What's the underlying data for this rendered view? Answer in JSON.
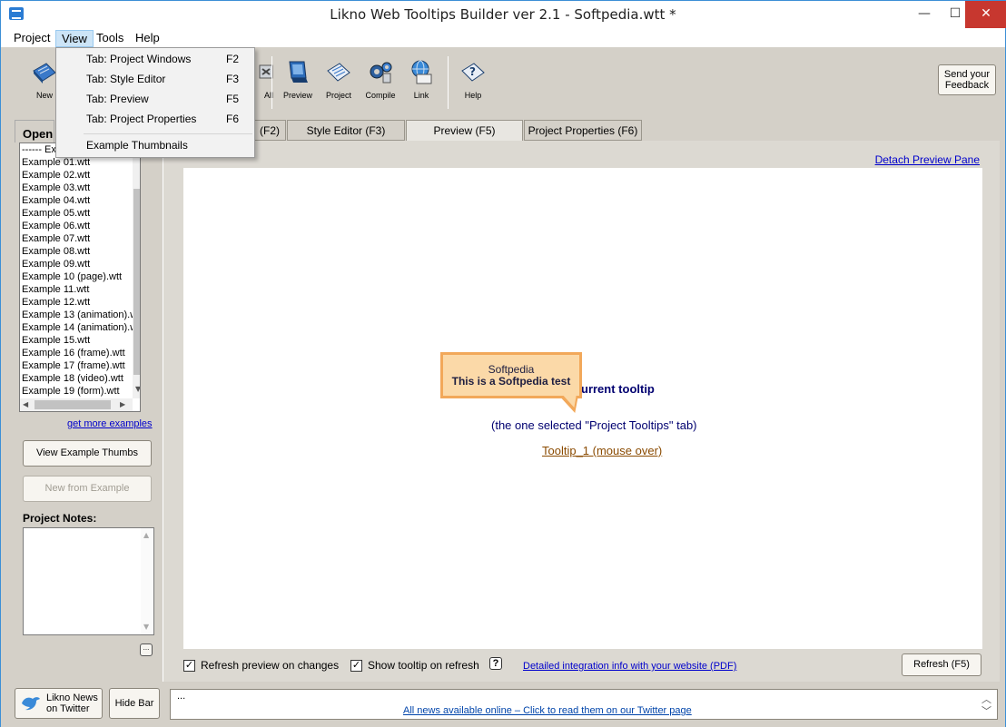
{
  "window": {
    "title": "Likno Web Tooltips Builder ver 2.1 - Softpedia.wtt *",
    "min": "—",
    "max": "☐",
    "close": "✕"
  },
  "menubar": {
    "items": [
      "Project",
      "View",
      "Tools",
      "Help"
    ],
    "active": "View"
  },
  "view_menu": {
    "items": [
      {
        "label": "Tab: Project Windows",
        "shortcut": "F2"
      },
      {
        "label": "Tab: Style Editor",
        "shortcut": "F3"
      },
      {
        "label": "Tab: Preview",
        "shortcut": "F5"
      },
      {
        "label": "Tab: Project Properties",
        "shortcut": "F6"
      },
      {
        "label": "Example Thumbnails",
        "shortcut": ""
      }
    ]
  },
  "toolbar": {
    "new": "New",
    "all": "All",
    "preview": "Preview",
    "project": "Project",
    "compile": "Compile",
    "link": "Link",
    "help": "Help",
    "feedback_line1": "Send your",
    "feedback_line2": "Feedback"
  },
  "tabs": [
    {
      "label": "(F2)",
      "active": false
    },
    {
      "label": "Style Editor   (F3)",
      "active": false
    },
    {
      "label": "Preview   (F5)",
      "active": true
    },
    {
      "label": "Project Properties   (F6)",
      "active": false
    }
  ],
  "left_panel": {
    "open_label": "Open",
    "files": [
      "------ Exa",
      "Example 01.wtt",
      "Example 02.wtt",
      "Example 03.wtt",
      "Example 04.wtt",
      "Example 05.wtt",
      "Example 06.wtt",
      "Example 07.wtt",
      "Example 08.wtt",
      "Example 09.wtt",
      "Example 10 (page).wtt",
      "Example 11.wtt",
      "Example 12.wtt",
      "Example 13 (animation).w",
      "Example 14 (animation).w",
      "Example 15.wtt",
      "Example 16 (frame).wtt",
      "Example 17 (frame).wtt",
      "Example 18 (video).wtt",
      "Example 19 (form).wtt"
    ],
    "more_examples": "get more examples",
    "view_thumbs": "View Example Thumbs",
    "new_from_example": "New from Example",
    "notes_label": "Project Notes:",
    "ellipsis": "..."
  },
  "preview": {
    "detach_link": "Detach Preview Pane",
    "heading_fragment": "urrent tooltip",
    "subtext": "(the one selected  \"Project Tooltips\" tab)",
    "tooltip_link": "Tooltip_1 (mouse over)",
    "tooltip_title": "Softpedia",
    "tooltip_body": "This is a Softpedia test"
  },
  "options": {
    "refresh_on_changes": "Refresh preview on changes",
    "show_tooltip": "Show tooltip on refresh",
    "help": "?",
    "integration_link": "Detailed integration info with your website (PDF)",
    "refresh_button": "Refresh (F5)",
    "check": "✓"
  },
  "bottom": {
    "news_line1": "Likno News",
    "news_line2": "on Twitter",
    "hide_bar": "Hide Bar",
    "news_prefix": "...",
    "news_link": "All news available online – Click to read them on our Twitter page"
  }
}
